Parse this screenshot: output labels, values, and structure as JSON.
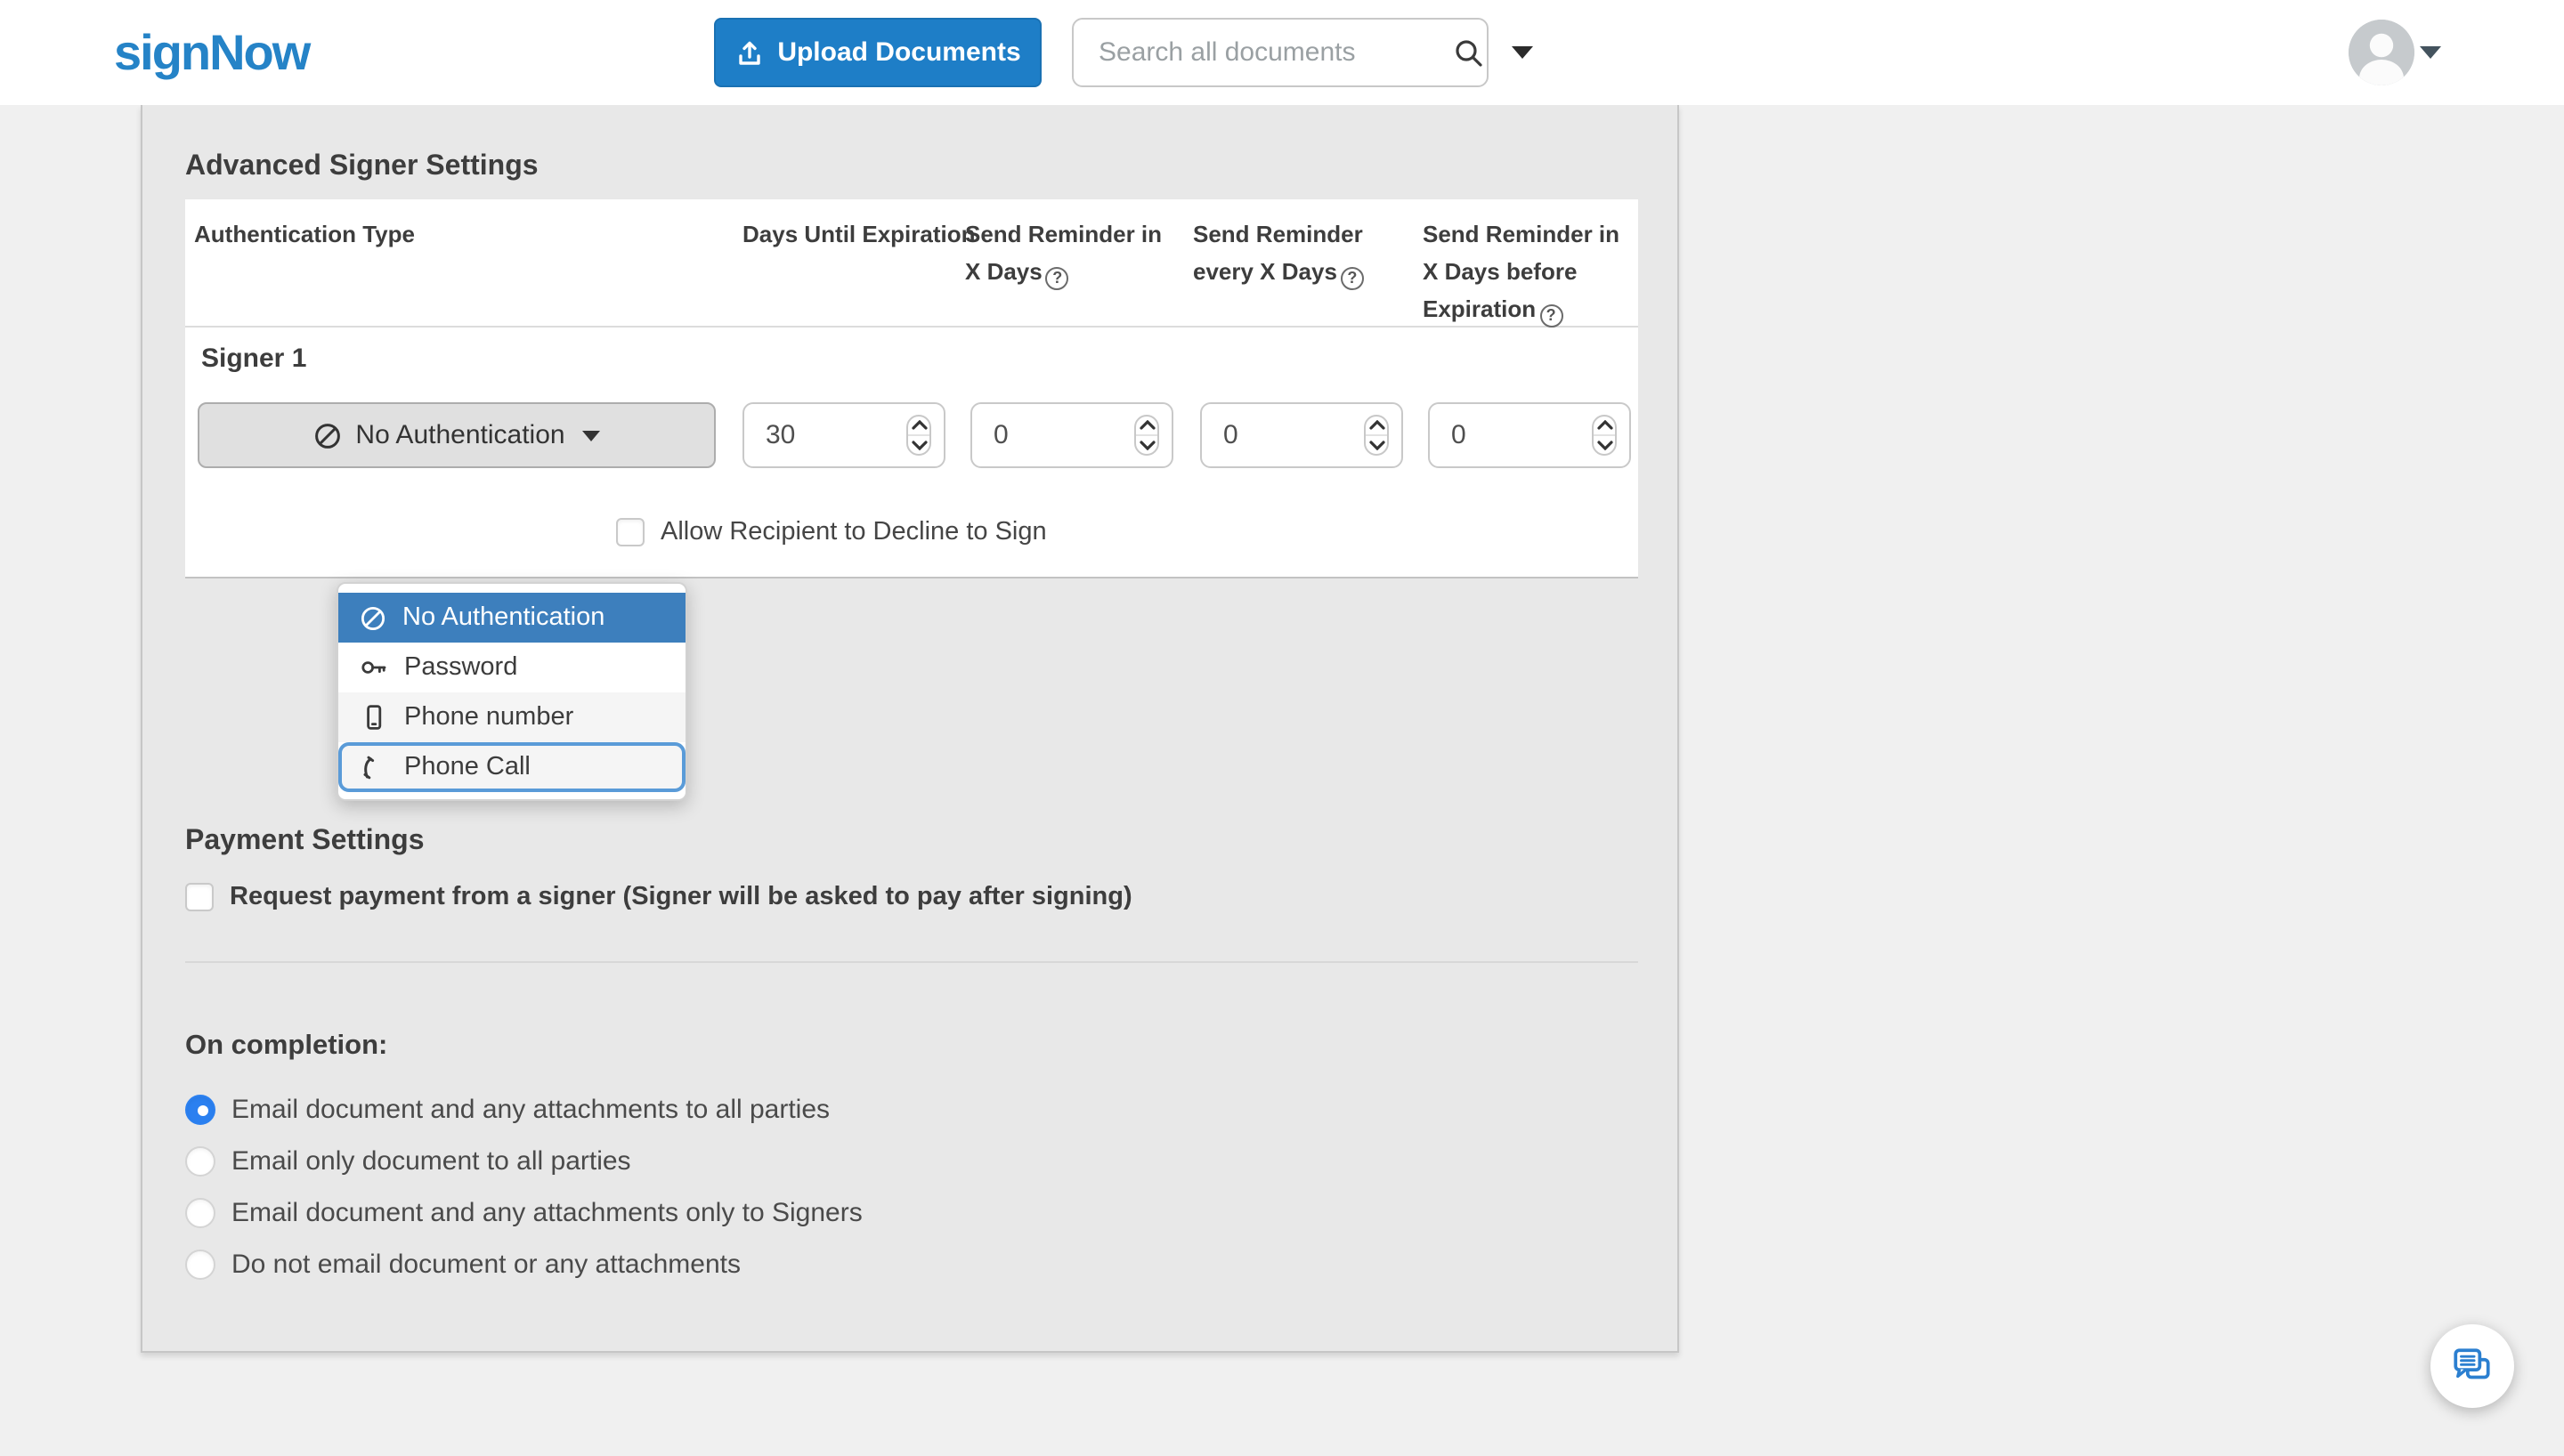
{
  "header": {
    "logo": "signNow",
    "upload_button_label": "Upload Documents",
    "search_placeholder": "Search all documents"
  },
  "panel": {
    "title": "Advanced Signer Settings",
    "table": {
      "auth_header": "Authentication Type",
      "signer_label": "Signer 1",
      "auth_button_label": "No Authentication",
      "columns": [
        {
          "header": "Days Until Expiration",
          "has_help": false,
          "value": "30"
        },
        {
          "header": "Send Reminder in X Days",
          "has_help": true,
          "value": "0"
        },
        {
          "header": "Send Reminder every X Days",
          "has_help": true,
          "value": "0"
        },
        {
          "header": "Send Reminder in X Days before Expiration",
          "has_help": true,
          "value": "0"
        }
      ]
    },
    "auth_menu": {
      "items": [
        {
          "icon": "no-auth-icon",
          "label": "No Authentication",
          "state": "selected"
        },
        {
          "icon": "key-icon",
          "label": "Password",
          "state": "normal"
        },
        {
          "icon": "mobile-icon",
          "label": "Phone number",
          "state": "shaded"
        },
        {
          "icon": "phone-icon",
          "label": "Phone Call",
          "state": "focused"
        }
      ]
    },
    "decline_checkbox_label": "Allow Recipient to Decline to Sign",
    "payment": {
      "title": "Payment Settings",
      "checkbox_label": "Request payment from a signer (Signer will be asked to pay after signing)",
      "checked": false
    },
    "completion": {
      "title": "On completion:",
      "selected_index": 0,
      "options": [
        "Email document and any attachments to all parties",
        "Email only document to all parties",
        "Email document and any attachments only to Signers",
        "Do not email document or any attachments"
      ]
    }
  },
  "icons": {
    "help": "?"
  },
  "colors": {
    "accent_blue": "#1e7ec7",
    "logo_blue": "#2583c7",
    "menu_selected_blue": "#3d7fbd",
    "radio_blue": "#2b80f0",
    "focus_ring": "#5a9bd8",
    "page_bg": "#f0f0f0",
    "panel_bg": "#e8e8e8"
  }
}
